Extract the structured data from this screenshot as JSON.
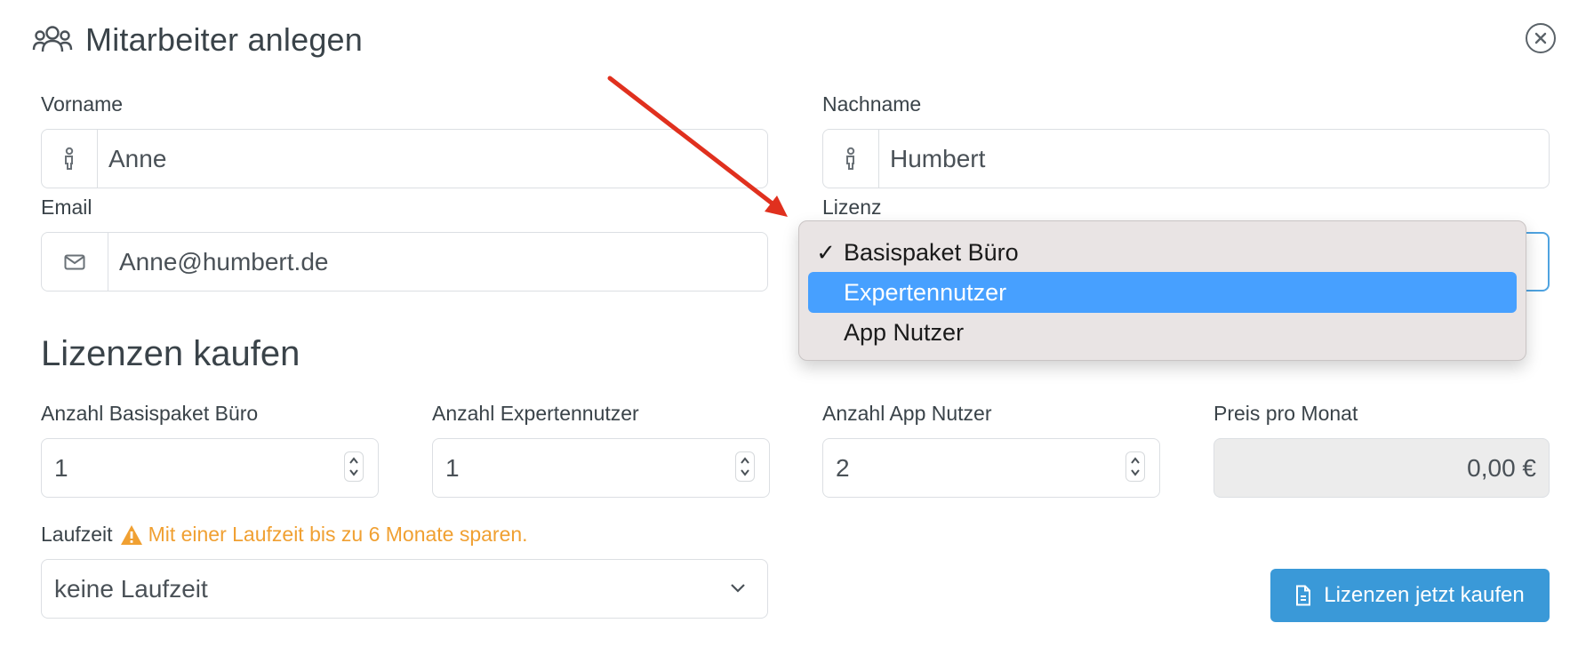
{
  "header": {
    "title": "Mitarbeiter anlegen",
    "icon": "users-icon",
    "close_icon": "close-circle-icon"
  },
  "form": {
    "vorname": {
      "label": "Vorname",
      "value": "Anne",
      "icon": "person-icon"
    },
    "nachname": {
      "label": "Nachname",
      "value": "Humbert",
      "icon": "person-icon"
    },
    "email": {
      "label": "Email",
      "value": "Anne@humbert.de",
      "icon": "envelope-icon"
    },
    "lizenz": {
      "label": "Lizenz",
      "selected": "Basispaket Büro"
    }
  },
  "dropdown": {
    "options": [
      {
        "label": "Basispaket Büro",
        "checked": true,
        "highlighted": false
      },
      {
        "label": "Expertennutzer",
        "checked": false,
        "highlighted": true
      },
      {
        "label": "App Nutzer",
        "checked": false,
        "highlighted": false
      }
    ],
    "check_mark": "✓",
    "highlight_color": "#47a0ff"
  },
  "licenses": {
    "heading": "Lizenzen kaufen",
    "basis": {
      "label": "Anzahl Basispaket Büro",
      "value": "1"
    },
    "experten": {
      "label": "Anzahl Expertennutzer",
      "value": "1"
    },
    "app": {
      "label": "Anzahl App Nutzer",
      "value": "2"
    },
    "preis": {
      "label": "Preis pro Monat",
      "value": "0,00 €"
    },
    "laufzeit": {
      "label": "Laufzeit",
      "warning": "Mit einer Laufzeit bis zu 6 Monate sparen.",
      "selected": "keine Laufzeit"
    },
    "buy_button": "Lizenzen jetzt kaufen"
  },
  "colors": {
    "accent": "#3a99d8",
    "warning": "#f0a032",
    "arrow": "#e0301e"
  }
}
